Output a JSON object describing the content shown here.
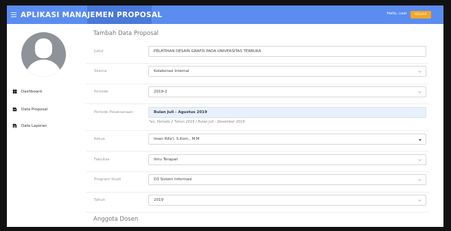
{
  "header": {
    "brand": "APLIKASI MANAJEMEN PROPOSAL",
    "greeting": "Hello, user",
    "logout_label": "KELUAR"
  },
  "sidebar": {
    "items": [
      {
        "label": "Dashboard",
        "icon": "dashboard-icon"
      },
      {
        "label": "Data Proposal",
        "icon": "document-icon"
      },
      {
        "label": "Data Laporan",
        "icon": "report-icon"
      }
    ]
  },
  "form": {
    "title": "Tambah Data Proposal",
    "fields": [
      {
        "label": "Judul",
        "value": "PELATIHAN DESAIN GRAFIS PADA UNIVERSITAS TERBUKA",
        "type": "text"
      },
      {
        "label": "Skema",
        "value": "Kolaborasi Internal",
        "type": "select"
      },
      {
        "label": "Periode",
        "value": "2019-2",
        "type": "select"
      },
      {
        "label": "Periode Pelaksanaan",
        "value": "Bulan Juli - Agustus 2019",
        "type": "highlight"
      },
      {
        "label": "Ketua",
        "value": "Iman Rifa'i, S.Kom., M.M",
        "type": "select-caret"
      },
      {
        "label": "Fakultas",
        "value": "Ilmu Terapan",
        "type": "select"
      },
      {
        "label": "Program Studi",
        "value": "D3 Sistem Informasi",
        "type": "select"
      },
      {
        "label": "Tahun",
        "value": "2019",
        "type": "select"
      }
    ],
    "period_hint": "*ex. Periode 2 Tahun 2019 / Bulan Juli - Desember 2019",
    "subsection_title": "Anggota Dosen"
  },
  "colors": {
    "header_bg": "#5b8df0",
    "logout_bg": "#f6a623",
    "highlight_field_bg": "#e8f1fb"
  }
}
